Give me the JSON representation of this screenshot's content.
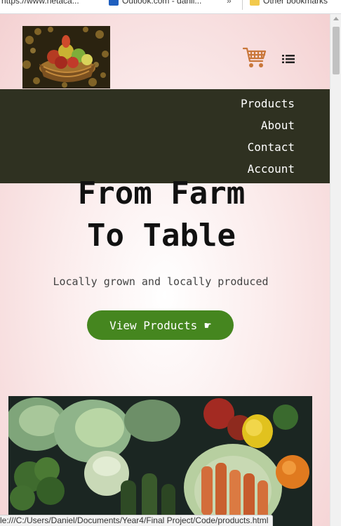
{
  "bookmarks": [
    {
      "label": "https://www.netaca...",
      "icon": "link-icon"
    },
    {
      "label": "Outlook.com - danii...",
      "icon": "outlook-icon"
    },
    {
      "label": "»",
      "icon": "more-chevron-icon"
    },
    {
      "label": "Other bookmarks",
      "icon": "folder-icon"
    }
  ],
  "header": {
    "logo_alt": "basket of fruit",
    "cart_icon": "cart-icon",
    "menu_icon": "list-menu-icon",
    "cart_color": "#c9773a"
  },
  "nav": {
    "items": [
      "Products",
      "About",
      "Contact",
      "Account"
    ],
    "background": "#2f3121"
  },
  "hero": {
    "title_line1": "From Farm",
    "title_line2": "To Table",
    "subtitle": "Locally grown and locally produced",
    "cta_label": "View Products",
    "cta_icon": "☛",
    "cta_color": "#45861f"
  },
  "statusbar": {
    "url": "le:///C:/Users/Daniel/Documents/Year4/Final Project/Code/products.html"
  }
}
